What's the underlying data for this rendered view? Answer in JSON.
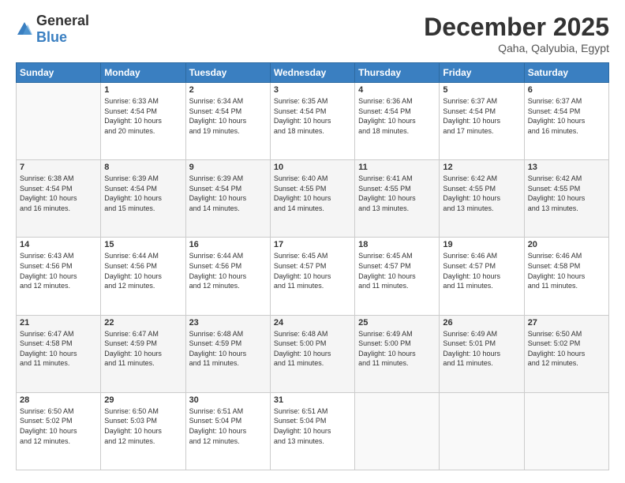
{
  "header": {
    "logo_general": "General",
    "logo_blue": "Blue",
    "month_title": "December 2025",
    "location": "Qaha, Qalyubia, Egypt"
  },
  "weekdays": [
    "Sunday",
    "Monday",
    "Tuesday",
    "Wednesday",
    "Thursday",
    "Friday",
    "Saturday"
  ],
  "weeks": [
    [
      {
        "day": "",
        "info": ""
      },
      {
        "day": "1",
        "info": "Sunrise: 6:33 AM\nSunset: 4:54 PM\nDaylight: 10 hours\nand 20 minutes."
      },
      {
        "day": "2",
        "info": "Sunrise: 6:34 AM\nSunset: 4:54 PM\nDaylight: 10 hours\nand 19 minutes."
      },
      {
        "day": "3",
        "info": "Sunrise: 6:35 AM\nSunset: 4:54 PM\nDaylight: 10 hours\nand 18 minutes."
      },
      {
        "day": "4",
        "info": "Sunrise: 6:36 AM\nSunset: 4:54 PM\nDaylight: 10 hours\nand 18 minutes."
      },
      {
        "day": "5",
        "info": "Sunrise: 6:37 AM\nSunset: 4:54 PM\nDaylight: 10 hours\nand 17 minutes."
      },
      {
        "day": "6",
        "info": "Sunrise: 6:37 AM\nSunset: 4:54 PM\nDaylight: 10 hours\nand 16 minutes."
      }
    ],
    [
      {
        "day": "7",
        "info": "Sunrise: 6:38 AM\nSunset: 4:54 PM\nDaylight: 10 hours\nand 16 minutes."
      },
      {
        "day": "8",
        "info": "Sunrise: 6:39 AM\nSunset: 4:54 PM\nDaylight: 10 hours\nand 15 minutes."
      },
      {
        "day": "9",
        "info": "Sunrise: 6:39 AM\nSunset: 4:54 PM\nDaylight: 10 hours\nand 14 minutes."
      },
      {
        "day": "10",
        "info": "Sunrise: 6:40 AM\nSunset: 4:55 PM\nDaylight: 10 hours\nand 14 minutes."
      },
      {
        "day": "11",
        "info": "Sunrise: 6:41 AM\nSunset: 4:55 PM\nDaylight: 10 hours\nand 13 minutes."
      },
      {
        "day": "12",
        "info": "Sunrise: 6:42 AM\nSunset: 4:55 PM\nDaylight: 10 hours\nand 13 minutes."
      },
      {
        "day": "13",
        "info": "Sunrise: 6:42 AM\nSunset: 4:55 PM\nDaylight: 10 hours\nand 13 minutes."
      }
    ],
    [
      {
        "day": "14",
        "info": "Sunrise: 6:43 AM\nSunset: 4:56 PM\nDaylight: 10 hours\nand 12 minutes."
      },
      {
        "day": "15",
        "info": "Sunrise: 6:44 AM\nSunset: 4:56 PM\nDaylight: 10 hours\nand 12 minutes."
      },
      {
        "day": "16",
        "info": "Sunrise: 6:44 AM\nSunset: 4:56 PM\nDaylight: 10 hours\nand 12 minutes."
      },
      {
        "day": "17",
        "info": "Sunrise: 6:45 AM\nSunset: 4:57 PM\nDaylight: 10 hours\nand 11 minutes."
      },
      {
        "day": "18",
        "info": "Sunrise: 6:45 AM\nSunset: 4:57 PM\nDaylight: 10 hours\nand 11 minutes."
      },
      {
        "day": "19",
        "info": "Sunrise: 6:46 AM\nSunset: 4:57 PM\nDaylight: 10 hours\nand 11 minutes."
      },
      {
        "day": "20",
        "info": "Sunrise: 6:46 AM\nSunset: 4:58 PM\nDaylight: 10 hours\nand 11 minutes."
      }
    ],
    [
      {
        "day": "21",
        "info": "Sunrise: 6:47 AM\nSunset: 4:58 PM\nDaylight: 10 hours\nand 11 minutes."
      },
      {
        "day": "22",
        "info": "Sunrise: 6:47 AM\nSunset: 4:59 PM\nDaylight: 10 hours\nand 11 minutes."
      },
      {
        "day": "23",
        "info": "Sunrise: 6:48 AM\nSunset: 4:59 PM\nDaylight: 10 hours\nand 11 minutes."
      },
      {
        "day": "24",
        "info": "Sunrise: 6:48 AM\nSunset: 5:00 PM\nDaylight: 10 hours\nand 11 minutes."
      },
      {
        "day": "25",
        "info": "Sunrise: 6:49 AM\nSunset: 5:00 PM\nDaylight: 10 hours\nand 11 minutes."
      },
      {
        "day": "26",
        "info": "Sunrise: 6:49 AM\nSunset: 5:01 PM\nDaylight: 10 hours\nand 11 minutes."
      },
      {
        "day": "27",
        "info": "Sunrise: 6:50 AM\nSunset: 5:02 PM\nDaylight: 10 hours\nand 12 minutes."
      }
    ],
    [
      {
        "day": "28",
        "info": "Sunrise: 6:50 AM\nSunset: 5:02 PM\nDaylight: 10 hours\nand 12 minutes."
      },
      {
        "day": "29",
        "info": "Sunrise: 6:50 AM\nSunset: 5:03 PM\nDaylight: 10 hours\nand 12 minutes."
      },
      {
        "day": "30",
        "info": "Sunrise: 6:51 AM\nSunset: 5:04 PM\nDaylight: 10 hours\nand 12 minutes."
      },
      {
        "day": "31",
        "info": "Sunrise: 6:51 AM\nSunset: 5:04 PM\nDaylight: 10 hours\nand 13 minutes."
      },
      {
        "day": "",
        "info": ""
      },
      {
        "day": "",
        "info": ""
      },
      {
        "day": "",
        "info": ""
      }
    ]
  ],
  "row_shades": [
    false,
    true,
    false,
    true,
    false
  ]
}
